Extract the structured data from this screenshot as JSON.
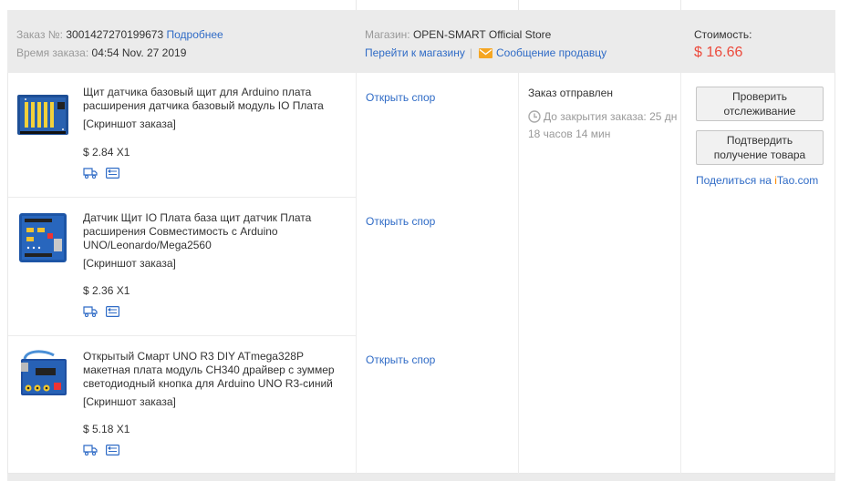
{
  "header": {
    "order_no_label": "Заказ №:",
    "order_no": "3001427270199673",
    "details_link": "Подробнее",
    "order_time_label": "Время заказа:",
    "order_time": "04:54 Nov. 27 2019",
    "store_label": "Магазин:",
    "store_name": "OPEN-SMART Official Store",
    "go_to_store": "Перейти к магазину",
    "message_seller": "Сообщение продавцу",
    "cost_label": "Стоимость:",
    "cost_value": "$ 16.66"
  },
  "items": [
    {
      "title": "Щит датчика базовый щит для Arduino плата расширения датчика базовый модуль IO Плата",
      "snapshot": "[Скриншот заказа]",
      "price": "$ 2.84 X1",
      "dispute": "Открыть спор",
      "icons": [
        "delivery-truck-icon",
        "return-icon"
      ]
    },
    {
      "title": "Датчик Щит IO Плата база щит датчик Плата расширения Совместимость с Arduino UNO/Leonardo/Mega2560",
      "snapshot": "[Скриншот заказа]",
      "price": "$ 2.36 X1",
      "dispute": "Открыть спор",
      "icons": [
        "delivery-truck-icon",
        "return-icon"
      ]
    },
    {
      "title": "Открытый Смарт UNO R3 DIY ATmega328P макетная плата модуль CH340 драйвер с зуммер светодиодный кнопка для Arduino UNO R3-синий",
      "snapshot": "[Скриншот заказа]",
      "price": "$ 5.18 X1",
      "dispute": "Открыть спор",
      "icons": [
        "delivery-truck-icon",
        "return-icon"
      ]
    }
  ],
  "status": {
    "state": "Заказ отправлен",
    "countdown": "До закрытия заказа: 25 дн 18 часов 14 мин"
  },
  "actions": {
    "track_button": "Проверить отслеживание",
    "confirm_button": "Подтвердить получение товара",
    "share_text": "Поделиться на",
    "share_brand_i": "i",
    "share_brand_rest": "Tao.com"
  },
  "colors": {
    "link": "#2f6bc6",
    "price_accent": "#ec4a3c",
    "header_bg": "#ebebeb",
    "itao_orange": "#ff8a00"
  }
}
